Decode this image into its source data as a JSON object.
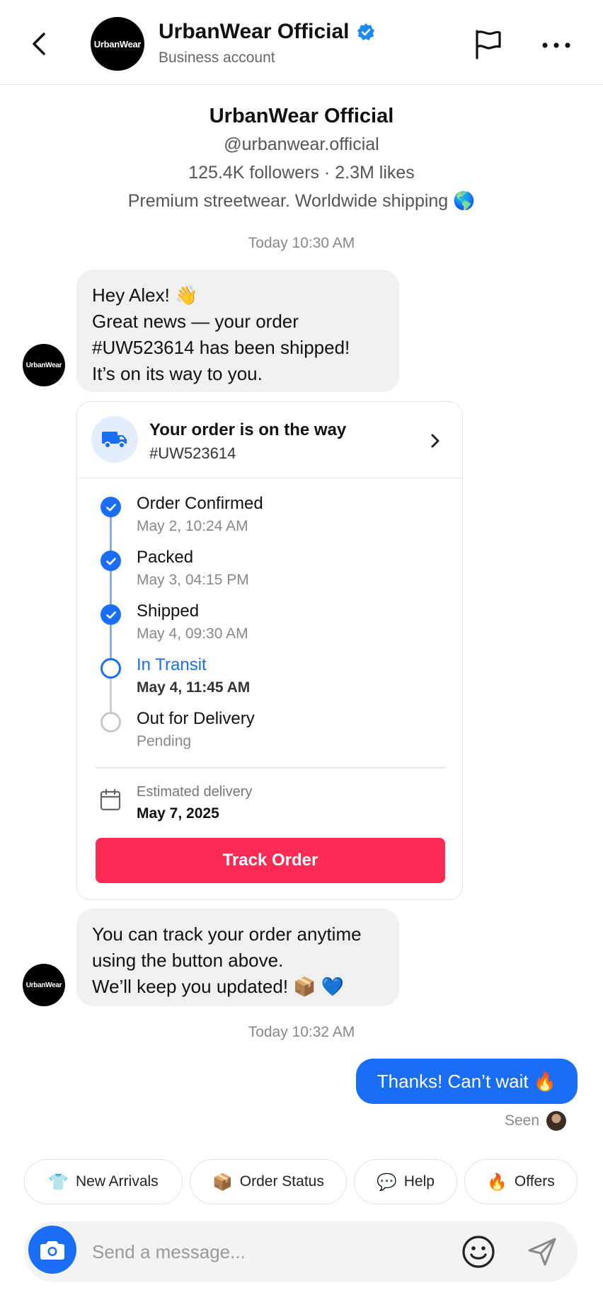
{
  "header": {
    "back_icon": "chevron-left-icon",
    "avatar_text": "UrbanWear",
    "name": "UrbanWear Official",
    "verified_icon": "verified-badge-icon",
    "subtitle": "Business account",
    "flag_icon": "flag-icon",
    "more_icon": "more-horizontal-icon"
  },
  "profile": {
    "name": "UrbanWear Official",
    "handle": "@urbanwear.official",
    "stats": "125.4K followers · 2.3M likes",
    "bio": "Premium streetwear. Worldwide shipping 🌎"
  },
  "timestamps": [
    "Today 10:30 AM",
    "Today 10:32 AM"
  ],
  "messages": {
    "first": {
      "avatar_text": "UrbanWear",
      "lines": [
        "Hey Alex! 👋",
        "Great news — your order",
        "#UW523614 has been shipped!",
        "It’s on its way to you."
      ]
    },
    "second": {
      "avatar_text": "UrbanWear",
      "lines": [
        "You can track your order anytime",
        "using the button above.",
        "We’ll keep you updated! 📦 💙"
      ]
    },
    "outgoing": "Thanks! Can’t wait 🔥",
    "seen": "Seen"
  },
  "order_card": {
    "title": "Your order is on the way",
    "order_number": "#UW523614",
    "steps": [
      {
        "label": "Order Confirmed",
        "date": "May 2, 10:24 AM",
        "status": "done"
      },
      {
        "label": "Packed",
        "date": "May 3, 04:15 PM",
        "status": "done"
      },
      {
        "label": "Shipped",
        "date": "May 4, 09:30 AM",
        "status": "done"
      },
      {
        "label": "In Transit",
        "date": "May 4, 11:45 AM",
        "status": "current"
      },
      {
        "label": "Out for Delivery",
        "date": "Pending",
        "status": "pending"
      }
    ],
    "estimated_label": "Estimated delivery",
    "estimated_date": "May 7, 2025",
    "track_button": "Track Order"
  },
  "quick_replies": [
    {
      "emoji": "👕",
      "label": "New Arrivals"
    },
    {
      "emoji": "📦",
      "label": "Order Status"
    },
    {
      "emoji": "💬",
      "label": "Help"
    },
    {
      "emoji": "🔥",
      "label": "Offers"
    }
  ],
  "composer": {
    "placeholder": "Send a message...",
    "camera_icon": "camera-icon",
    "emoji_icon": "smiley-icon",
    "send_icon": "send-icon"
  },
  "colors": {
    "accent_blue": "#1a6ef5",
    "track_button": "#fe2c55",
    "bubble_incoming": "#f0f0f0"
  }
}
